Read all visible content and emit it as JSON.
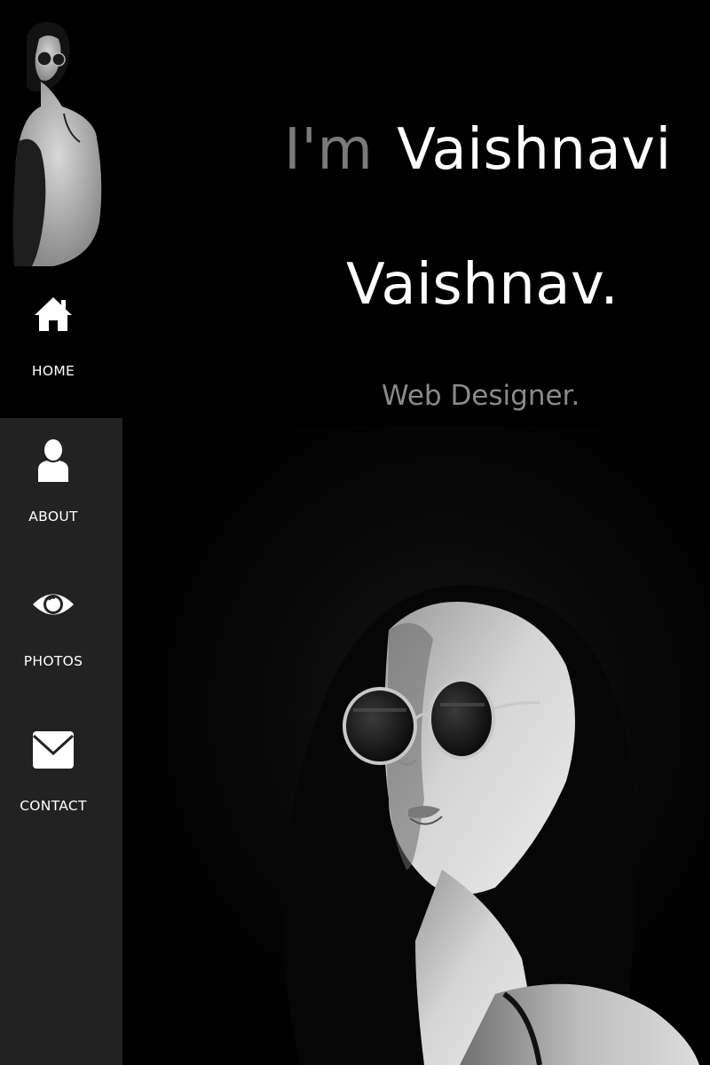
{
  "sidebar": {
    "items": [
      {
        "label": "HOME",
        "icon": "home-icon",
        "active": true
      },
      {
        "label": "ABOUT",
        "icon": "user-icon",
        "active": false
      },
      {
        "label": "PHOTOS",
        "icon": "eye-icon",
        "active": false
      },
      {
        "label": "CONTACT",
        "icon": "envelope-icon",
        "active": false
      }
    ]
  },
  "hero": {
    "prefix": "I'm",
    "name_first": "Vaishnavi",
    "name_last": "Vaishnav.",
    "role": "Web Designer."
  },
  "colors": {
    "background": "#000000",
    "sidebar": "#222222",
    "text": "#ffffff",
    "muted": "#7a7a7a"
  }
}
